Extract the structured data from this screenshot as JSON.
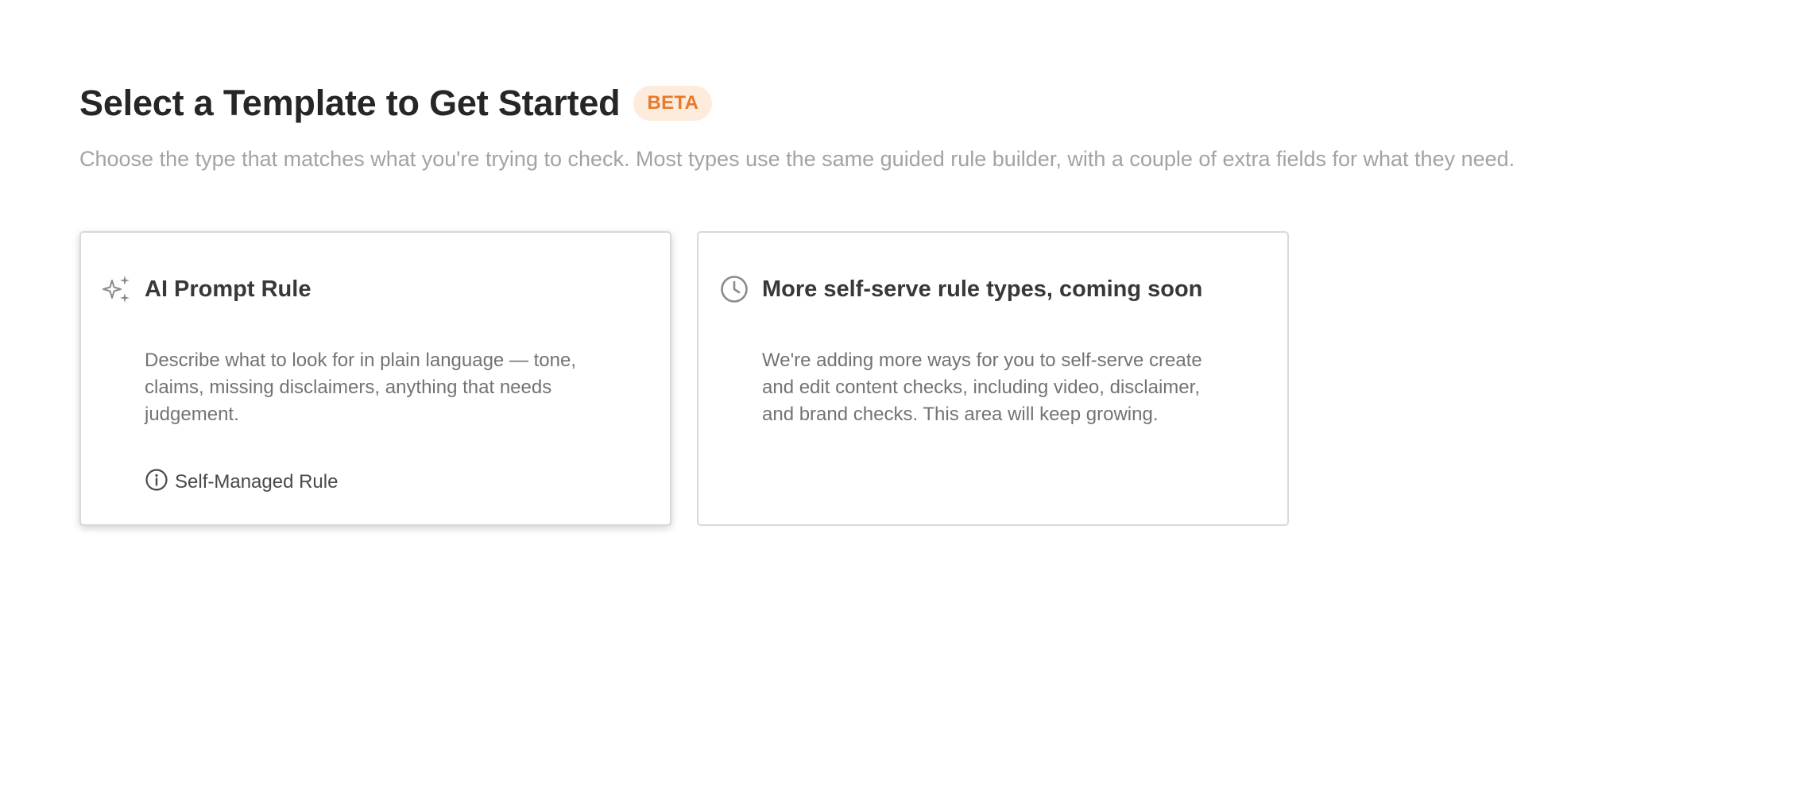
{
  "header": {
    "title": "Select a Template to Get Started",
    "badge": "BETA",
    "subtitle": "Choose the type that matches what you're trying to check. Most types use the same guided rule builder, with a couple of extra fields for what they need."
  },
  "cards": [
    {
      "icon": "sparkles-icon",
      "title": "AI Prompt Rule",
      "description": "Describe what to look for in plain language — tone, claims, missing disclaimers, anything that needs judgement.",
      "footer_icon": "info-icon",
      "footer_label": "Self-Managed Rule"
    },
    {
      "icon": "clock-icon",
      "title": "More self-serve rule types, coming soon",
      "description": "We're adding more ways for you to self-serve create and edit content checks, including video, disclaimer, and brand checks. This area will keep growing."
    }
  ],
  "colors": {
    "badge_bg": "#fdebdc",
    "badge_text": "#e67a2e",
    "subtitle": "#a3a3a3",
    "card_border": "#d9d9d9"
  }
}
